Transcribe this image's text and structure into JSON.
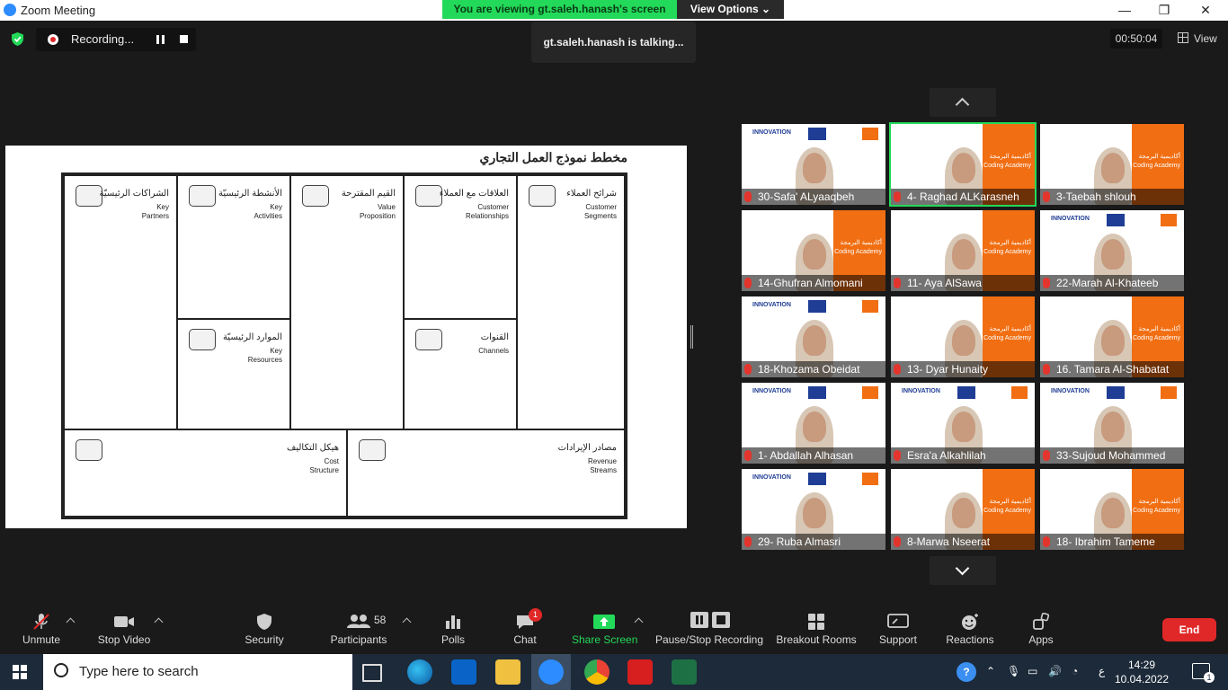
{
  "window": {
    "title": "Zoom Meeting",
    "minimize": "—",
    "maximize": "❐",
    "close": "✕"
  },
  "banner": {
    "viewing": "You are viewing gt.saleh.hanash's screen",
    "view_options": "View Options ⌄"
  },
  "recording": {
    "label": "Recording..."
  },
  "talking": "gt.saleh.hanash is talking...",
  "timer": "00:50:04",
  "view_button": "View",
  "canvas": {
    "title": "مخطط نموذج العمل التجاري",
    "cells": [
      {
        "ar": "الشراكات الرئيسيّة",
        "en": "Key\nPartners",
        "icon": "chain-icon"
      },
      {
        "ar": "الأنشطة الرئيسيّة",
        "en": "Key\nActivities",
        "icon": "worker-icon"
      },
      {
        "ar": "القيم المقترحة",
        "en": "Value\nProposition",
        "icon": "gift-icon"
      },
      {
        "ar": "العلاقات مع العملاء",
        "en": "Customer\nRelationships",
        "icon": "heart-icon"
      },
      {
        "ar": "شرائح العملاء",
        "en": "Customer\nSegments",
        "icon": "person-icon"
      },
      {
        "ar": "الموارد الرئيسيّة",
        "en": "Key\nResources",
        "icon": "worker-icon"
      },
      {
        "ar": "القنوات",
        "en": "Channels",
        "icon": "truck-icon"
      },
      {
        "ar": "هيكل التكاليف",
        "en": "Cost\nStructure",
        "icon": "receipt-icon"
      },
      {
        "ar": "مصادر الإيرادات",
        "en": "Revenue\nStreams",
        "icon": "cash-register-icon"
      }
    ]
  },
  "participants": [
    {
      "name": "30-Safa' ALyaaqbeh",
      "style": "innovation"
    },
    {
      "name": "4- Raghad ALKarasneh",
      "style": "academy",
      "speaking": true
    },
    {
      "name": "3-Taebah shlouh",
      "style": "academy"
    },
    {
      "name": "14-Ghufran Almomani",
      "style": "academy"
    },
    {
      "name": "11- Aya AlSawa",
      "style": "academy"
    },
    {
      "name": "22-Marah Al-Khateeb",
      "style": "innovation"
    },
    {
      "name": "18-Khozama Obeidat",
      "style": "innovation"
    },
    {
      "name": "13- Dyar Hunaity",
      "style": "academy"
    },
    {
      "name": "16. Tamara Al-Shabatat",
      "style": "academy"
    },
    {
      "name": "1- Abdallah Alhasan",
      "style": "innovation"
    },
    {
      "name": "Esra'a Alkahlilah",
      "style": "innovation"
    },
    {
      "name": "33-Sujoud Mohammed",
      "style": "innovation"
    },
    {
      "name": "29- Ruba Almasri",
      "style": "innovation"
    },
    {
      "name": "8-Marwa Nseerat",
      "style": "academy"
    },
    {
      "name": "18- Ibrahim Tameme",
      "style": "academy"
    }
  ],
  "brand": {
    "innovation": "INNOVATION",
    "academy_ar": "أكاديمية البرمجة",
    "academy_en": "Coding Academy"
  },
  "toolbar": {
    "unmute": "Unmute",
    "stop_video": "Stop Video",
    "security": "Security",
    "participants": "Participants",
    "participants_count": "58",
    "polls": "Polls",
    "chat": "Chat",
    "chat_badge": "1",
    "share_screen": "Share Screen",
    "pause_recording": "Pause/Stop Recording",
    "breakout_rooms": "Breakout Rooms",
    "support": "Support",
    "reactions": "Reactions",
    "apps": "Apps",
    "end": "End"
  },
  "taskbar": {
    "search_placeholder": "Type here to search",
    "time": "14:29",
    "date": "10.04.2022",
    "lang": "ع",
    "notifications": "1"
  },
  "colors": {
    "accent_green": "#23d959",
    "end_red": "#e02828",
    "orange": "#f16e12",
    "eu_blue": "#1f3d95"
  }
}
